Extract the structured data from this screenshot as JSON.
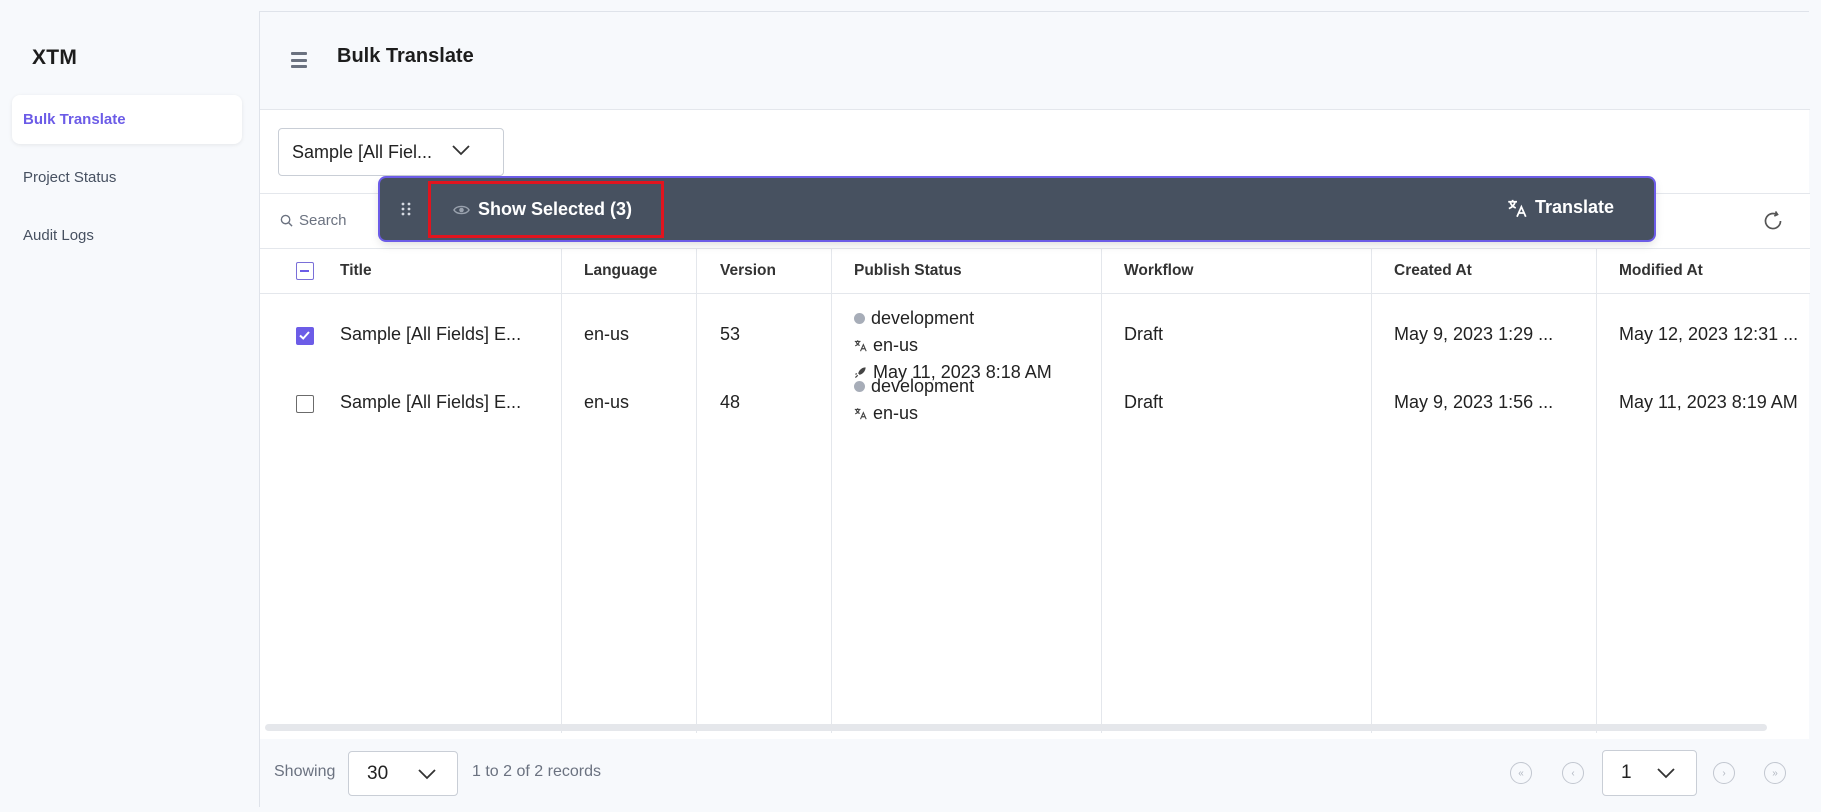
{
  "app": {
    "name": "XTM"
  },
  "sidebar": {
    "items": [
      {
        "label": "Bulk Translate",
        "active": true
      },
      {
        "label": "Project Status",
        "active": false
      },
      {
        "label": "Audit Logs",
        "active": false
      }
    ]
  },
  "header": {
    "title": "Bulk Translate"
  },
  "entry_select": {
    "value": "Sample [All Fiel..."
  },
  "search": {
    "placeholder": "Search"
  },
  "selection_bar": {
    "show_selected_label": "Show Selected (3)",
    "translate_label": "Translate"
  },
  "table": {
    "columns": [
      "Title",
      "Language",
      "Version",
      "Publish Status",
      "Workflow",
      "Created At",
      "Modified At"
    ],
    "rows": [
      {
        "checked": true,
        "title": "Sample [All Fields] E...",
        "language": "en-us",
        "version": "53",
        "publish_env": "development",
        "publish_locale": "en-us",
        "publish_date": "May 11, 2023 8:18 AM",
        "workflow": "Draft",
        "created_at": "May 9, 2023 1:29 ...",
        "modified_at": "May 12, 2023 12:31 ..."
      },
      {
        "checked": false,
        "title": "Sample [All Fields] E...",
        "language": "en-us",
        "version": "48",
        "publish_env": "development",
        "publish_locale": "en-us",
        "workflow": "Draft",
        "created_at": "May 9, 2023 1:56 ...",
        "modified_at": "May 11, 2023 8:19 AM"
      }
    ]
  },
  "footer": {
    "showing_label": "Showing",
    "page_size": "30",
    "records_text": "1 to 2 of 2 records",
    "current_page": "1"
  },
  "colors": {
    "accent": "#6c5ce7",
    "selection_bar": "#475160",
    "highlight_border": "#e1141e"
  }
}
